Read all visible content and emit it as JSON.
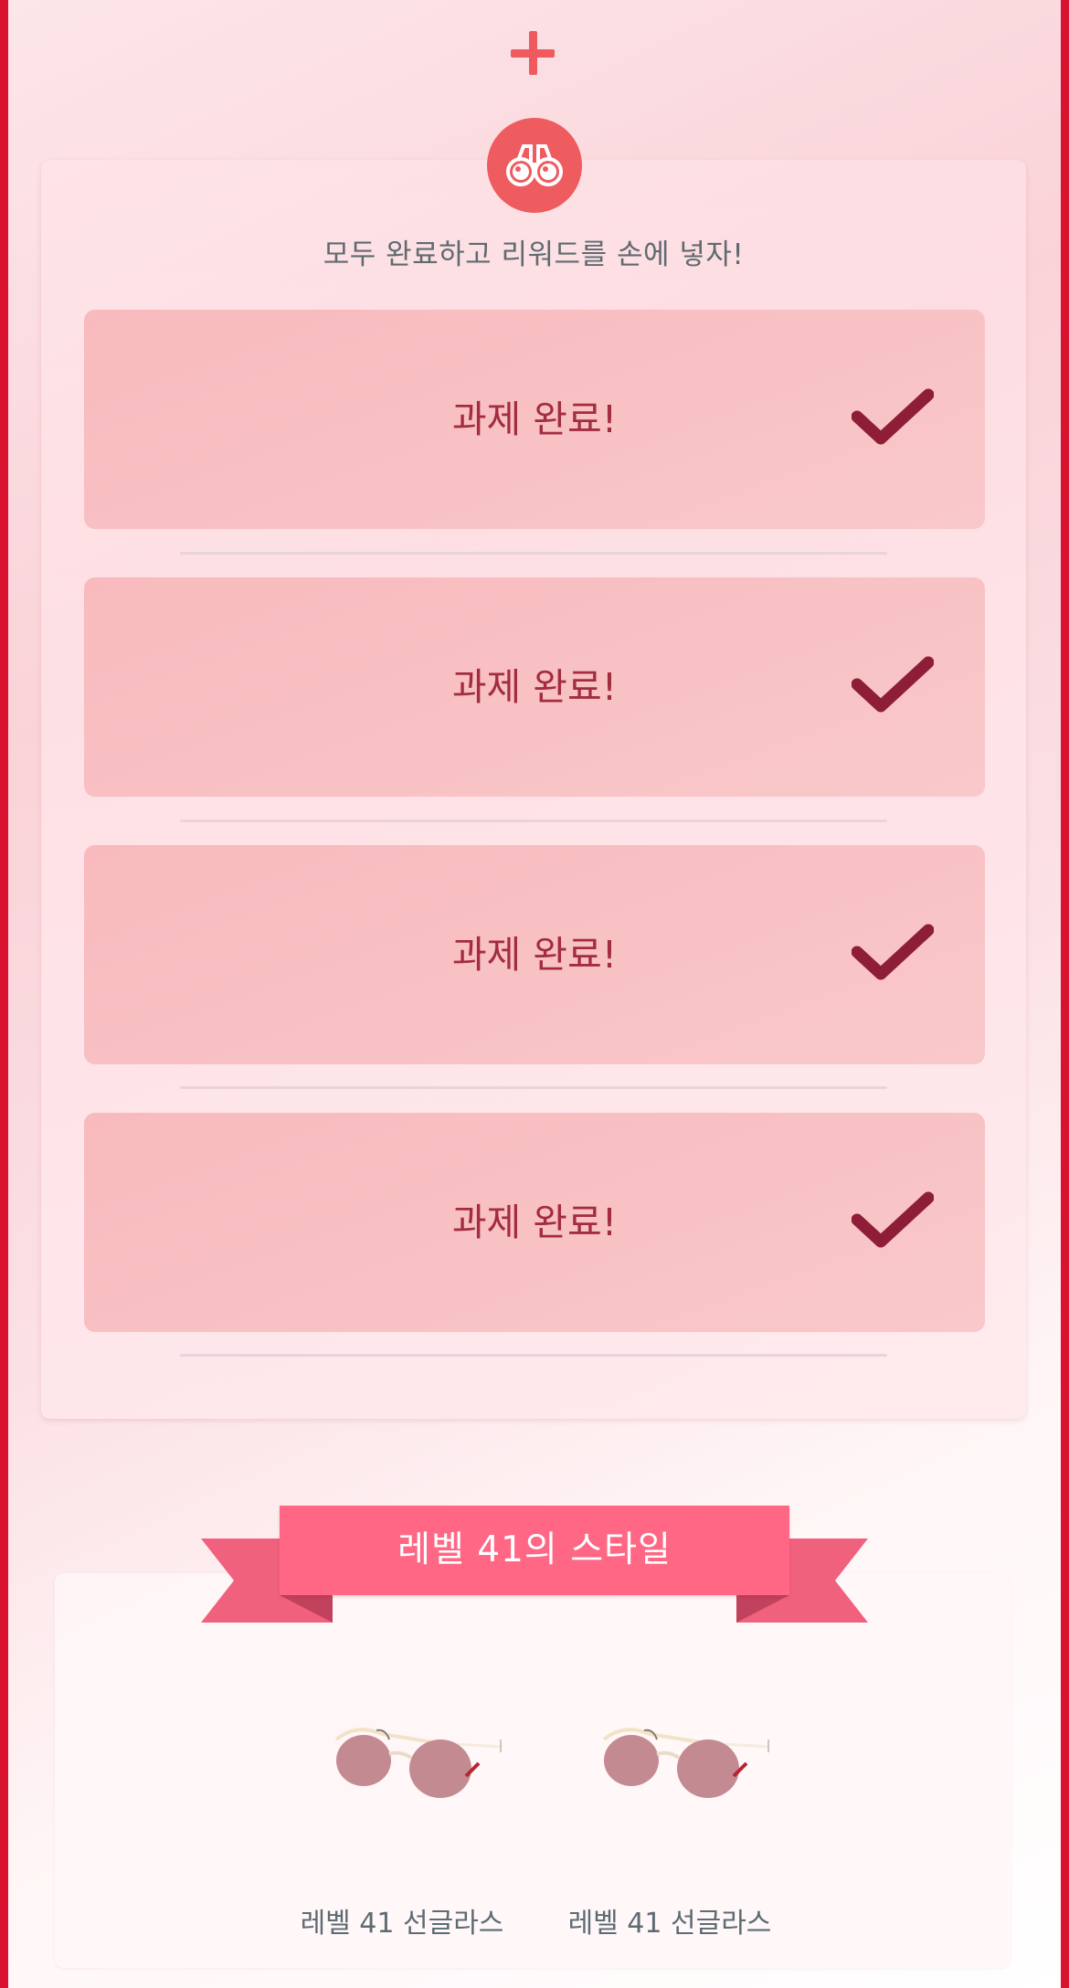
{
  "header": {
    "plus_icon": "plus-icon",
    "accent_color": "#ee5a5e"
  },
  "tasks_card": {
    "icon": "binoculars-icon",
    "subtitle": "모두 완료하고 리워드를 손에 넣자!",
    "items": [
      {
        "label": "과제 완료!",
        "status": "completed",
        "icon": "checkmark-icon"
      },
      {
        "label": "과제 완료!",
        "status": "completed",
        "icon": "checkmark-icon"
      },
      {
        "label": "과제 완료!",
        "status": "completed",
        "icon": "checkmark-icon"
      },
      {
        "label": "과제 완료!",
        "status": "completed",
        "icon": "checkmark-icon"
      }
    ]
  },
  "style_section": {
    "ribbon_title": "레벨 41의 스타일",
    "ribbon_color": "#ff6785",
    "items": [
      {
        "name": "레벨 41 선글라스",
        "icon": "sunglasses-icon"
      },
      {
        "name": "레벨 41 선글라스",
        "icon": "sunglasses-icon"
      }
    ]
  },
  "colors": {
    "frame": "#d9122f",
    "task_text": "#a32c40",
    "check": "#8e1d38"
  }
}
